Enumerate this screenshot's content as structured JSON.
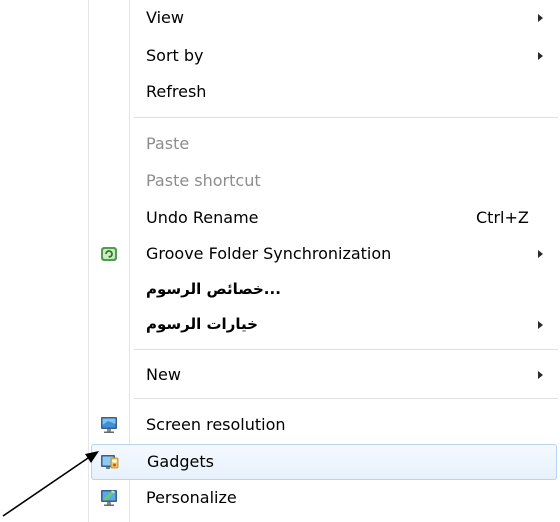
{
  "menu": {
    "items": [
      {
        "label": "View",
        "submenu": true
      },
      {
        "label": "Sort by",
        "submenu": true
      },
      {
        "label": "Refresh"
      },
      {
        "label": "Paste",
        "disabled": true
      },
      {
        "label": "Paste shortcut",
        "disabled": true
      },
      {
        "label": "Undo Rename",
        "shortcut": "Ctrl+Z"
      },
      {
        "label": "Groove Folder Synchronization",
        "submenu": true,
        "icon": "groove-icon"
      },
      {
        "label": "...خصائص الرسوم"
      },
      {
        "label": "خيارات الرسوم",
        "submenu": true
      },
      {
        "label": "New",
        "submenu": true
      },
      {
        "label": "Screen resolution",
        "icon": "monitor-icon"
      },
      {
        "label": "Gadgets",
        "icon": "gadgets-icon",
        "highlighted": true
      },
      {
        "label": "Personalize",
        "icon": "personalize-icon"
      }
    ]
  },
  "colors": {
    "highlight_border": "#b9d4ef",
    "highlight_fill": "#e7f1fc",
    "disabled_text": "#8d8d8d",
    "separator": "#e0e0e0"
  }
}
